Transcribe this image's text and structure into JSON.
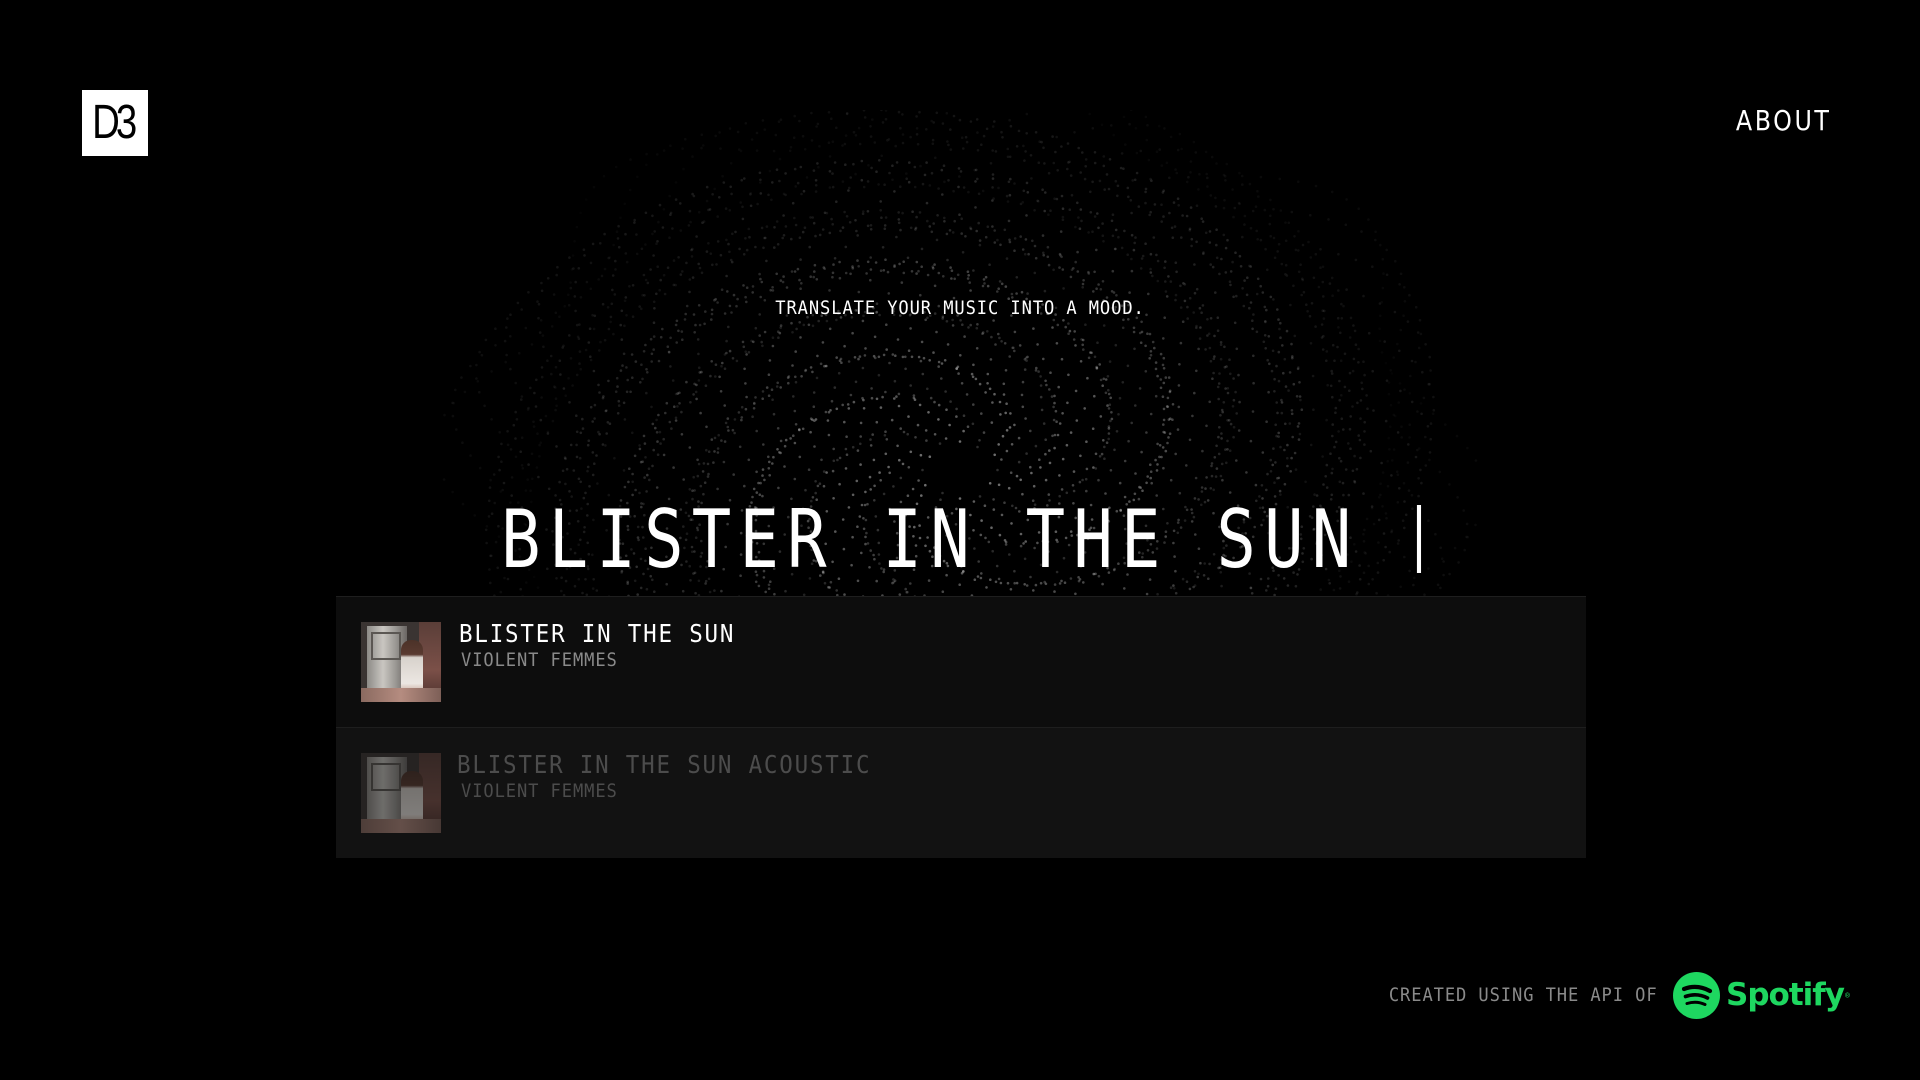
{
  "header": {
    "logo_text": "D3",
    "about_label": "ABOUT"
  },
  "hero": {
    "tagline": "TRANSLATE YOUR MUSIC INTO A MOOD.",
    "search_value": "BLISTER IN THE SUN "
  },
  "results": [
    {
      "title": "BLISTER IN THE SUN",
      "artist": "VIOLENT FEMMES",
      "state": "highlighted"
    },
    {
      "title": "BLISTER IN THE SUN ACOUSTIC",
      "artist": "VIOLENT FEMMES",
      "state": "dimmed"
    }
  ],
  "footer": {
    "credit_text": "CREATED USING THE API OF",
    "brand_name": "Spotify",
    "brand_color": "#1ED760"
  },
  "colors": {
    "background": "#000000",
    "text": "#FFFFFF",
    "muted_text": "#8A8A8A",
    "row_background": "#0D0D0D"
  },
  "icons": {
    "logo": "d3-logo",
    "spotify": "spotify-logo-icon"
  }
}
